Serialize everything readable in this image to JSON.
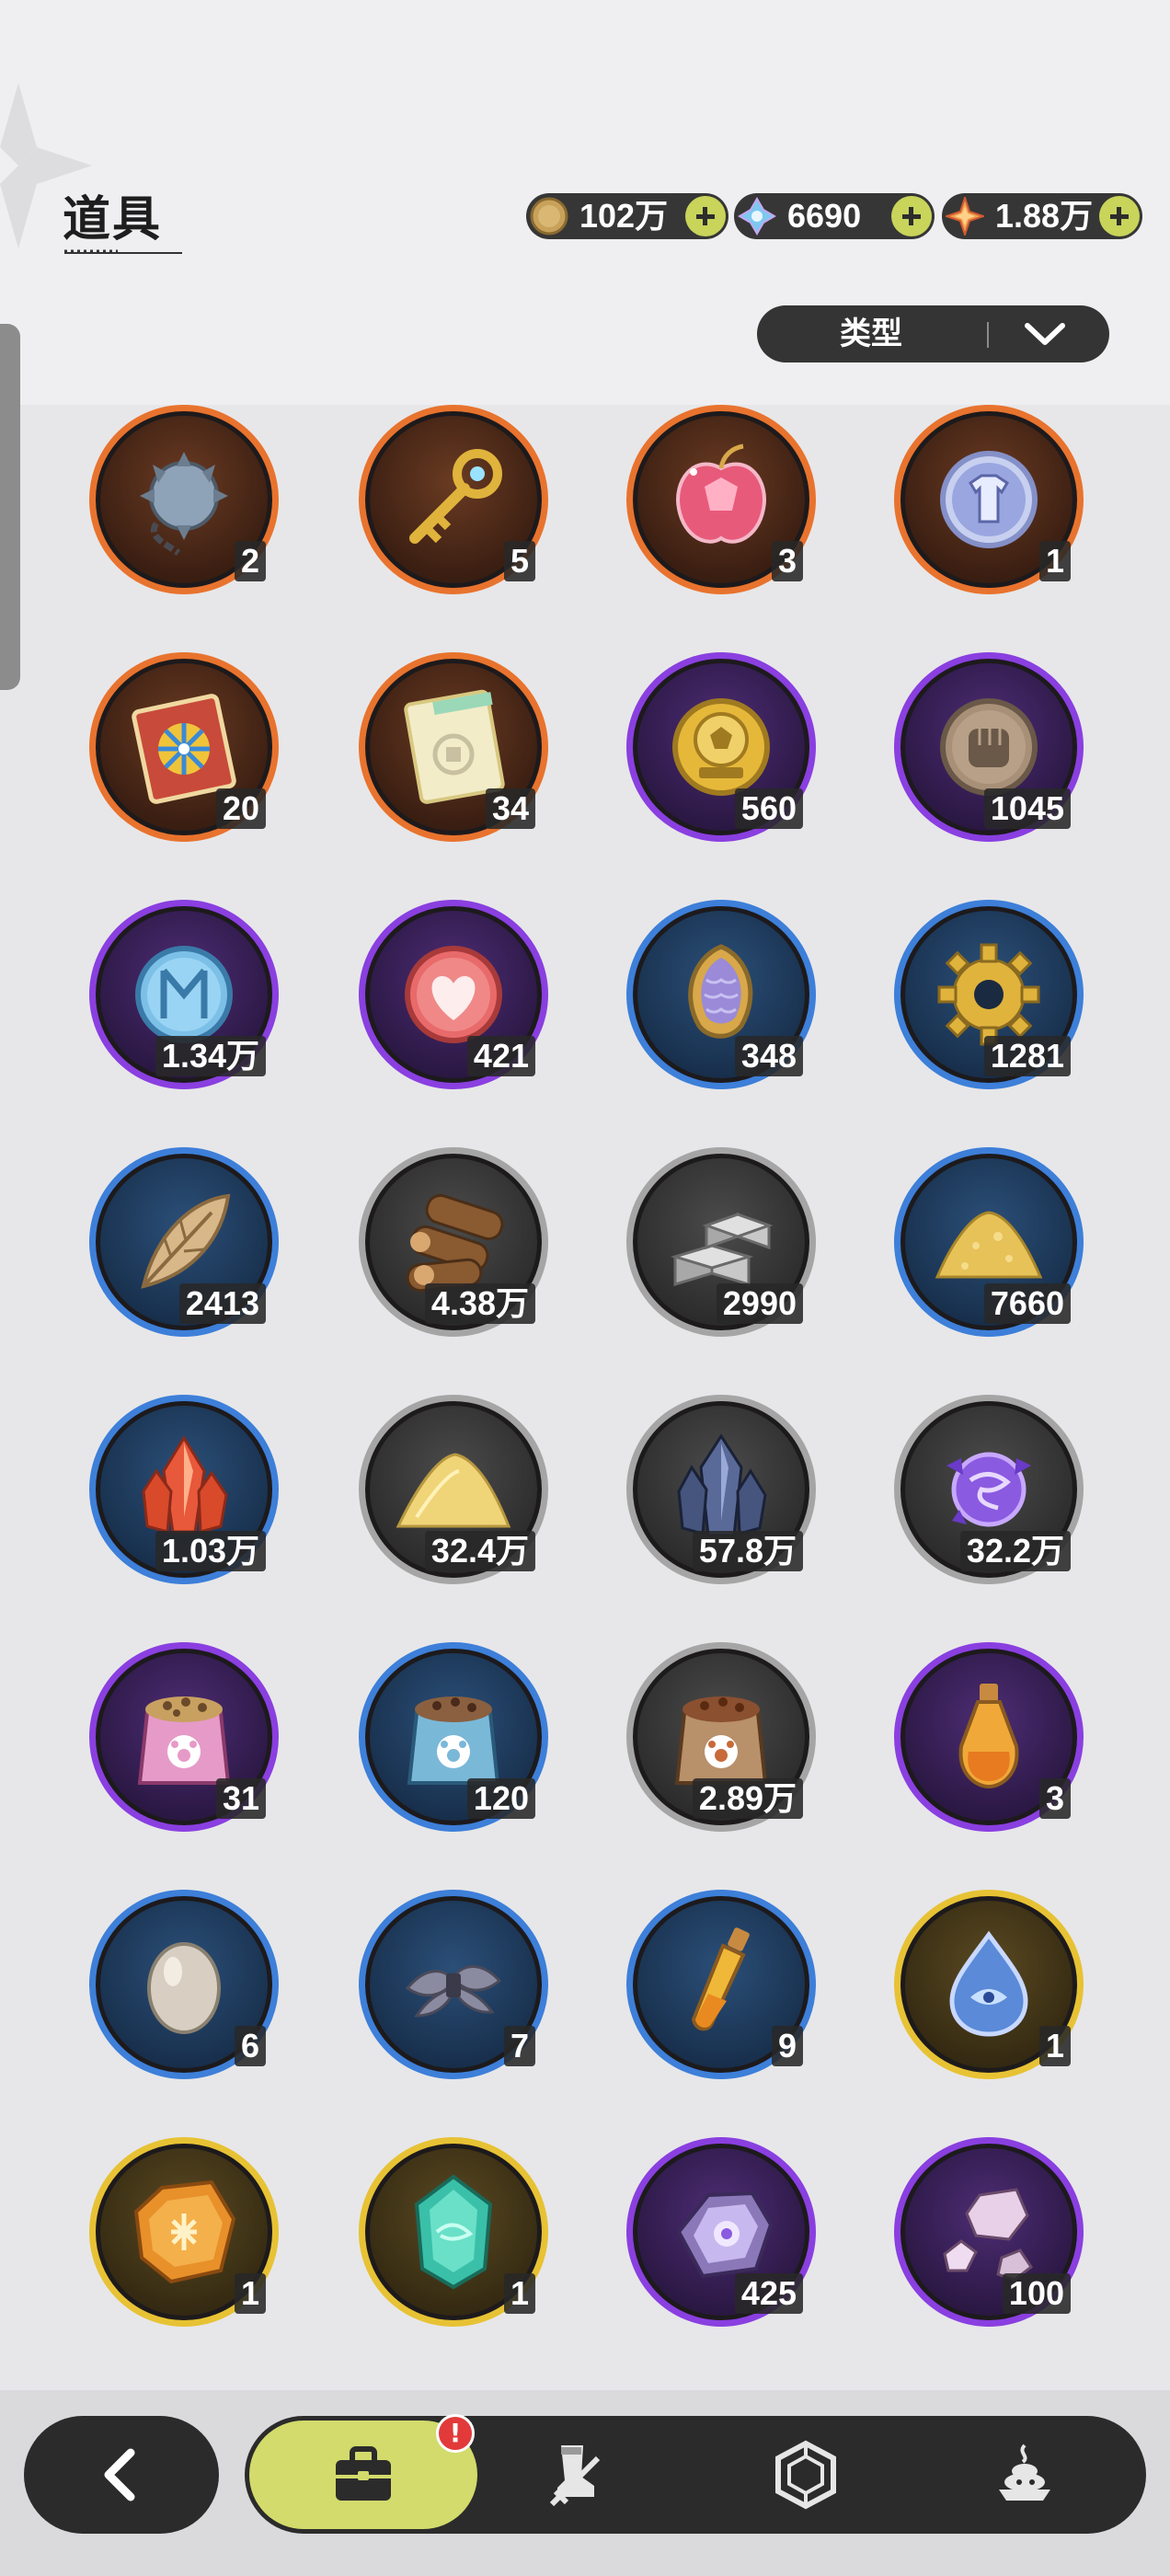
{
  "header": {
    "title": "道具",
    "currencies": [
      {
        "icon": "gold-coin-icon",
        "value": "102万"
      },
      {
        "icon": "crystal-icon",
        "value": "6690"
      },
      {
        "icon": "star-gem-icon",
        "value": "1.88万"
      }
    ],
    "filter_label": "类型"
  },
  "colors": {
    "accent": "#d2db6b",
    "rarity_orange": "#e8732e",
    "rarity_purple": "#8a3fe0",
    "rarity_blue": "#3d7fd9",
    "rarity_gray": "#a5a5a5",
    "rarity_gold": "#e7c234"
  },
  "items": [
    {
      "icon": "spiked-ball-icon",
      "rarity": "orange",
      "qty": "2"
    },
    {
      "icon": "golden-key-icon",
      "rarity": "orange",
      "qty": "5"
    },
    {
      "icon": "crystal-apple-icon",
      "rarity": "orange",
      "qty": "3"
    },
    {
      "icon": "shirt-token-icon",
      "rarity": "orange",
      "qty": "1"
    },
    {
      "icon": "wheel-ticket-icon",
      "rarity": "orange",
      "qty": "20"
    },
    {
      "icon": "puzzle-ticket-icon",
      "rarity": "orange",
      "qty": "34"
    },
    {
      "icon": "soccer-coin-icon",
      "rarity": "purple",
      "qty": "560"
    },
    {
      "icon": "fist-coin-icon",
      "rarity": "purple",
      "qty": "1045"
    },
    {
      "icon": "blue-coin-icon",
      "rarity": "purple",
      "qty": "1.34万"
    },
    {
      "icon": "heart-coin-icon",
      "rarity": "purple",
      "qty": "421"
    },
    {
      "icon": "scale-pendant-icon",
      "rarity": "blue",
      "qty": "348"
    },
    {
      "icon": "gear-coin-icon",
      "rarity": "blue",
      "qty": "1281"
    },
    {
      "icon": "leaf-icon",
      "rarity": "blue",
      "qty": "2413"
    },
    {
      "icon": "wood-logs-icon",
      "rarity": "gray",
      "qty": "4.38万"
    },
    {
      "icon": "stone-bricks-icon",
      "rarity": "gray",
      "qty": "2990"
    },
    {
      "icon": "gold-sand-icon",
      "rarity": "blue",
      "qty": "7660"
    },
    {
      "icon": "red-crystal-icon",
      "rarity": "blue",
      "qty": "1.03万"
    },
    {
      "icon": "yellow-sand-icon",
      "rarity": "gray",
      "qty": "32.4万"
    },
    {
      "icon": "dark-crystal-icon",
      "rarity": "gray",
      "qty": "57.8万"
    },
    {
      "icon": "purple-orb-icon",
      "rarity": "gray",
      "qty": "32.2万"
    },
    {
      "icon": "pink-food-bag-icon",
      "rarity": "purple",
      "qty": "31"
    },
    {
      "icon": "blue-food-bag-icon",
      "rarity": "blue",
      "qty": "120"
    },
    {
      "icon": "brown-food-bag-icon",
      "rarity": "gray",
      "qty": "2.89万"
    },
    {
      "icon": "potion-bottle-icon",
      "rarity": "purple",
      "qty": "3"
    },
    {
      "icon": "egg-icon",
      "rarity": "blue",
      "qty": "6"
    },
    {
      "icon": "feather-bundle-icon",
      "rarity": "blue",
      "qty": "7"
    },
    {
      "icon": "vial-icon",
      "rarity": "blue",
      "qty": "9"
    },
    {
      "icon": "water-drop-icon",
      "rarity": "gold",
      "qty": "1"
    },
    {
      "icon": "amber-gem-icon",
      "rarity": "gold",
      "qty": "1"
    },
    {
      "icon": "green-gem-icon",
      "rarity": "gold",
      "qty": "1"
    },
    {
      "icon": "purple-ore-icon",
      "rarity": "purple",
      "qty": "425"
    },
    {
      "icon": "pink-shards-icon",
      "rarity": "purple",
      "qty": "100"
    }
  ],
  "nav": {
    "back_icon": "chevron-left-icon",
    "tabs": [
      {
        "icon": "bag-icon",
        "active": true,
        "badge": "!"
      },
      {
        "icon": "boot-sword-icon",
        "active": false
      },
      {
        "icon": "hexagon-gem-icon",
        "active": false
      },
      {
        "icon": "dessert-icon",
        "active": false
      }
    ]
  }
}
